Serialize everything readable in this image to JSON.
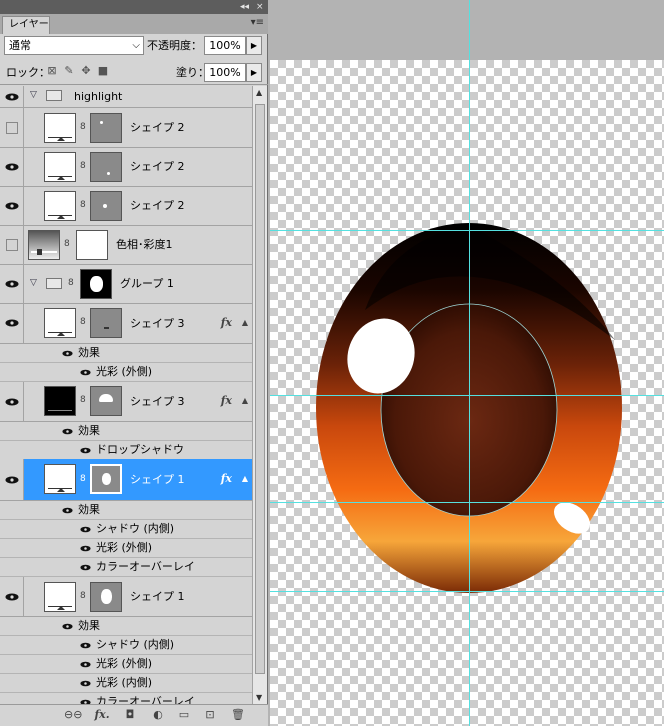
{
  "panel": {
    "tab_label": "レイヤー",
    "collapse_glyph": "◂◂",
    "close_glyph": "×",
    "menu_glyph": "▾≡",
    "blend_mode": "通常",
    "opacity_label": "不透明度：",
    "opacity_value": "100%",
    "lock_label": "ロック：",
    "fill_label": "塗り：",
    "fill_value": "100%"
  },
  "layers": {
    "group_highlight": "highlight",
    "shape2_a": "シェイプ 2",
    "shape2_b": "シェイプ 2",
    "shape2_c": "シェイプ 2",
    "hue_sat": "色相･彩度1",
    "group1": "グループ 1",
    "shape3_a": "シェイプ 3",
    "shape3_a_effects": "効果",
    "shape3_a_eff1": "光彩 (外側)",
    "shape3_b": "シェイプ 3",
    "shape3_b_effects": "効果",
    "shape3_b_eff1": "ドロップシャドウ",
    "shape1_a": "シェイプ 1",
    "shape1_a_effects": "効果",
    "shape1_a_eff1": "シャドウ (内側)",
    "shape1_a_eff2": "光彩 (外側)",
    "shape1_a_eff3": "カラーオーバーレイ",
    "shape1_b": "シェイプ 1",
    "shape1_b_effects": "効果",
    "shape1_b_eff1": "シャドウ (内側)",
    "shape1_b_eff2": "光彩 (外側)",
    "shape1_b_eff3": "光彩 (内側)",
    "shape1_b_eff4": "カラーオーバーレイ",
    "fx": "fx"
  },
  "bottom_toolbar": {
    "link": "⊖⊖",
    "fx": "fx.",
    "mask": "◘",
    "adjust": "◐",
    "folder": "▭",
    "new": "⊡",
    "trash": "🗑"
  },
  "colors": {
    "selection": "#3399ff",
    "guide": "#55e0e0",
    "iris_dark": "#3a1408",
    "iris_orange": "#f06b10"
  }
}
